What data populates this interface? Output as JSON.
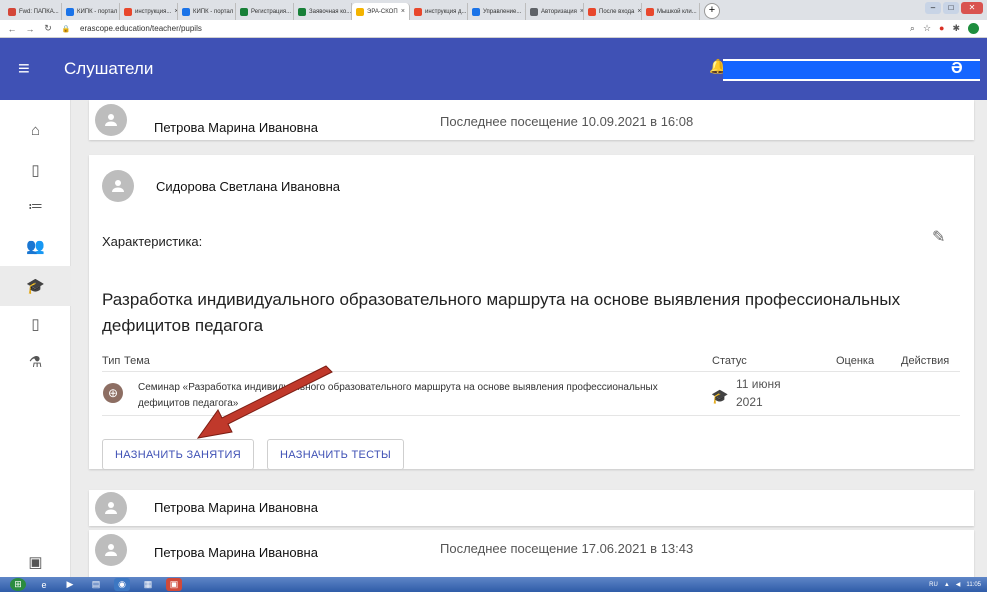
{
  "browser": {
    "tabs": [
      {
        "label": "Fwd: ПАПКА...",
        "color": "#d44638"
      },
      {
        "label": "КИПК - портал",
        "color": "#1a73e8"
      },
      {
        "label": "инструкция...",
        "color": "#e8472c"
      },
      {
        "label": "КИПК - портал",
        "color": "#1a73e8"
      },
      {
        "label": "Регистрация...",
        "color": "#188038"
      },
      {
        "label": "Заявочная ко...",
        "color": "#188038"
      },
      {
        "label": "ЭРА-СКОП",
        "color": "#f4b400"
      },
      {
        "label": "инструкция д...",
        "color": "#e8472c"
      },
      {
        "label": "Управление...",
        "color": "#1a73e8"
      },
      {
        "label": "Авторизация",
        "color": "#5f6368"
      },
      {
        "label": "После входа",
        "color": "#e8472c"
      },
      {
        "label": "Мышкой кли...",
        "color": "#e8472c"
      }
    ],
    "url": "erascope.education/teacher/pupils"
  },
  "header": {
    "title": "Слушатели"
  },
  "students": {
    "top": {
      "name": "Петрова Марина Ивановна",
      "last_visit": "Последнее посещение 10.09.2021 в 16:08"
    },
    "expanded": {
      "name": "Сидорова Светлана Ивановна",
      "characteristic_label": "Характеристика:",
      "course_title": "Разработка индивидуального образовательного маршрута на основе выявления профессиональных дефицитов педагога",
      "table_headers": {
        "type": "Тип",
        "topic": "Тема",
        "status": "Статус",
        "grade": "Оценка",
        "actions": "Действия"
      },
      "lesson": {
        "topic": "Семинар «Разработка индивидуального образовательного маршрута на основе выявления профессиональных дефицитов педагога»",
        "status_date": "11 июня 2021"
      },
      "assign_lessons_label": "НАЗНАЧИТЬ ЗАНЯТИЯ",
      "assign_tests_label": "НАЗНАЧИТЬ ТЕСТЫ"
    },
    "next": {
      "name": "Петрова Марина Ивановна"
    },
    "bottom": {
      "name": "Петрова Марина Ивановна",
      "last_visit": "Последнее посещение 17.06.2021 в 13:43"
    }
  },
  "taskbar": {
    "lang": "RU",
    "time": "11:05"
  },
  "colors": {
    "appbar": "#3f51b5",
    "redacted_user": "#1565ff",
    "arrow": "#c0392b"
  }
}
